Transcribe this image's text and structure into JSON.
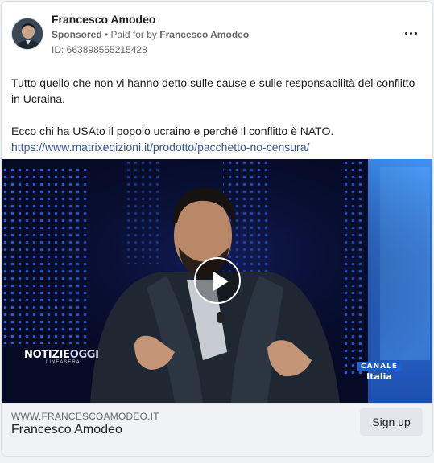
{
  "advertiser": {
    "name": "Francesco Amodeo",
    "sponsored_label": "Sponsored",
    "paid_for_prefix": "• Paid for by",
    "paid_for_name": "Francesco Amodeo",
    "ad_id": "ID: 663898555215428"
  },
  "post": {
    "paragraph_1": "Tutto quello che non vi hanno detto sulle cause e sulle responsabilità del conflitto in Ucraina.",
    "paragraph_2": "Ecco chi ha USAto il popolo ucraino e perché il conflitto è NATO.",
    "link": "https://www.matrixedizioni.it/prodotto/pacchetto-no-censura/"
  },
  "video": {
    "show_logo_part1": "NOTIZIE",
    "show_logo_part2": "OGGI",
    "show_logo_sub": "LINEASERA",
    "channel_logo_top": "CANALE",
    "channel_logo_bottom": "Italia"
  },
  "footer": {
    "domain": "WWW.FRANCESCOAMODEO.IT",
    "title": "Francesco Amodeo",
    "cta_label": "Sign up"
  },
  "colors": {
    "link": "#385898",
    "secondary_text": "#65676b",
    "video_background": "#050a25",
    "cta_background": "#e4e6eb"
  }
}
